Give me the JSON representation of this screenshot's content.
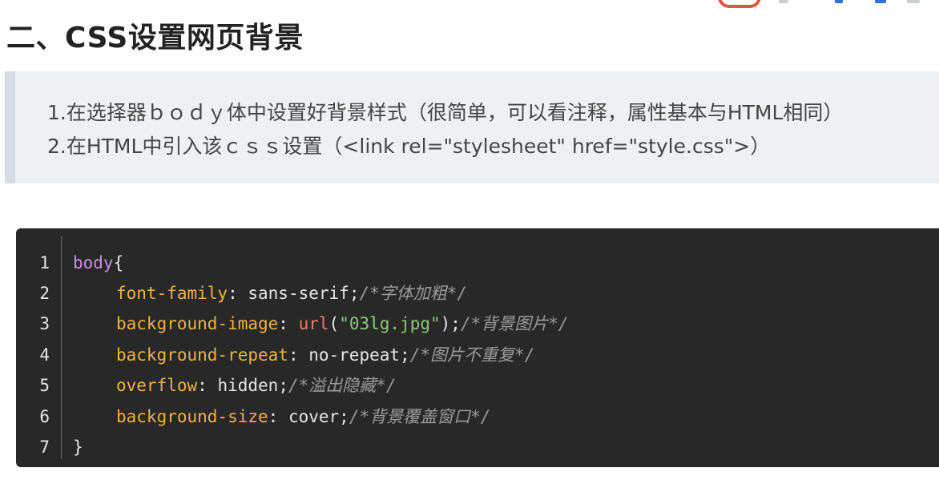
{
  "heading": "二、CSS设置网页背景",
  "quote": {
    "lines": [
      "1.在选择器ｂｏｄｙ体中设置好背景样式（很简单，可以看注释，属性基本与HTML相同）",
      "2.在HTML中引入该ｃｓｓ设置（<link rel=\"stylesheet\" href=\"style.css\">）"
    ]
  },
  "code": {
    "line_numbers": [
      "1",
      "2",
      "3",
      "4",
      "5",
      "6",
      "7"
    ],
    "selector": "body",
    "open_brace": "{",
    "close_brace": "}",
    "lines": [
      {
        "prop": "font-family",
        "sep": ": ",
        "value": "sans-serif",
        "end": ";",
        "comment": "/*字体加粗*/"
      },
      {
        "prop": "background-image",
        "sep": ": ",
        "fn": "url",
        "paren_open": "(",
        "str": "\"03lg.jpg\"",
        "paren_close": ")",
        "end": ";",
        "comment": "/*背景图片*/"
      },
      {
        "prop": "background-repeat",
        "sep": ": ",
        "value": "no-repeat",
        "end": ";",
        "comment": "/*图片不重复*/"
      },
      {
        "prop": "overflow",
        "sep": ": ",
        "value": "hidden",
        "end": ";",
        "comment": "/*溢出隐藏*/"
      },
      {
        "prop": "background-size",
        "sep": ": ",
        "value": "cover",
        "end": ";",
        "comment": "/*背景覆盖窗口*/"
      }
    ]
  },
  "colors": {
    "selector": "#c68fdb",
    "property": "#f2b23e",
    "function": "#ef7b6b",
    "string": "#8fc879",
    "comment": "#9a9a9a",
    "code_bg": "#282828",
    "quote_bg": "#eef0f4"
  }
}
